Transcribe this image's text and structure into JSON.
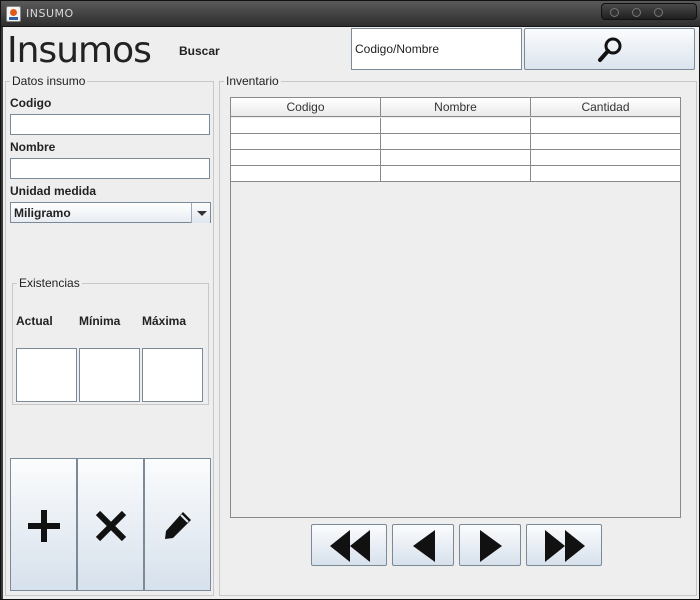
{
  "window": {
    "title": "INSUMO"
  },
  "header": {
    "title": "Insumos",
    "search_label": "Buscar",
    "search_value": "Codigo/Nombre",
    "search_icon": "search-icon"
  },
  "datos": {
    "group_label": "Datos insumo",
    "codigo_label": "Codigo",
    "codigo_value": "",
    "nombre_label": "Nombre",
    "nombre_value": "",
    "unidad_label": "Unidad medida",
    "unidad_value": "Miligramo",
    "existencias": {
      "group_label": "Existencias",
      "actual_label": "Actual",
      "minima_label": "Mínima",
      "maxima_label": "Máxima",
      "actual_value": "",
      "minima_value": "",
      "maxima_value": ""
    }
  },
  "actions": {
    "add_icon": "plus-icon",
    "delete_icon": "x-icon",
    "edit_icon": "pencil-icon"
  },
  "inventario": {
    "group_label": "Inventario",
    "columns": [
      "Codigo",
      "Nombre",
      "Cantidad"
    ],
    "rows": [
      [
        "",
        "",
        ""
      ],
      [
        "",
        "",
        ""
      ],
      [
        "",
        "",
        ""
      ],
      [
        "",
        "",
        ""
      ]
    ]
  },
  "navigation": {
    "first_icon": "double-left-icon",
    "prev_icon": "left-icon",
    "next_icon": "right-icon",
    "last_icon": "double-right-icon"
  }
}
